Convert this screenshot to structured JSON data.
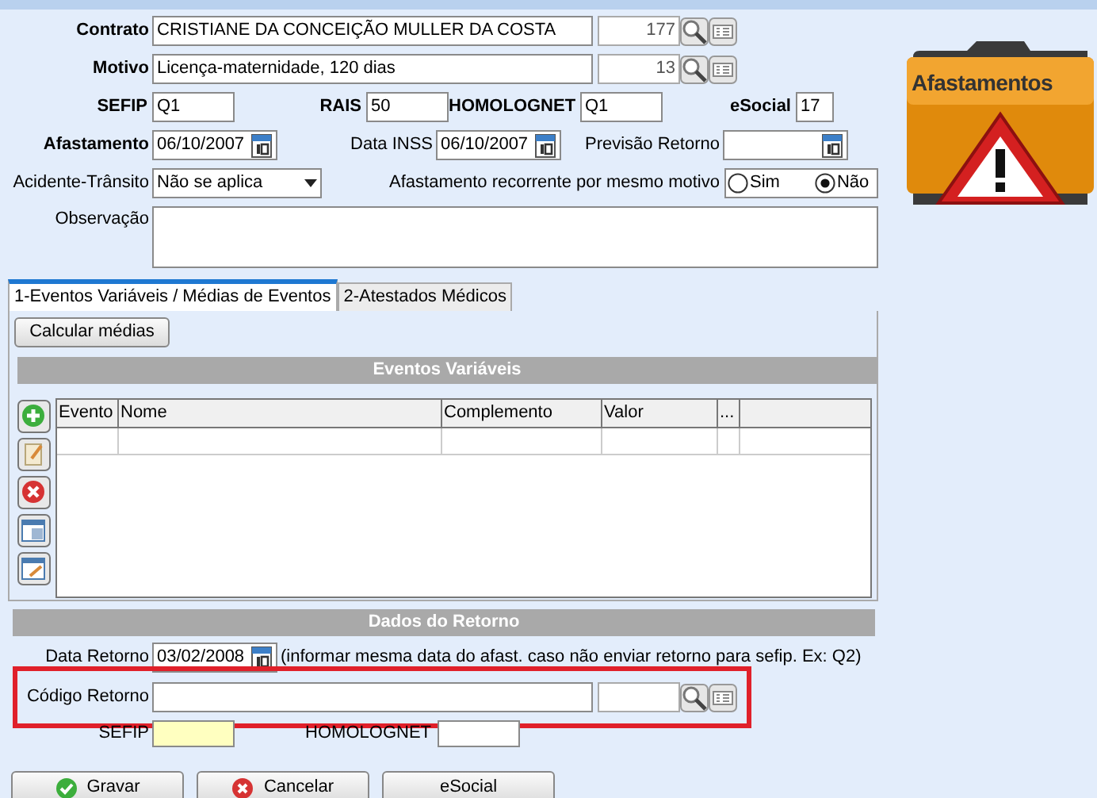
{
  "contrato": {
    "label": "Contrato",
    "value": "CRISTIANE DA CONCEIÇÃO MULLER DA COSTA",
    "code": "177"
  },
  "motivo": {
    "label": "Motivo",
    "value": "Licença-maternidade, 120 dias",
    "code": "13"
  },
  "codes": [
    {
      "label": "SEFIP",
      "value": "Q1"
    },
    {
      "label": "RAIS",
      "value": "50"
    },
    {
      "label": "HOMOLOGNET",
      "value": "Q1"
    },
    {
      "label": "eSocial",
      "value": "17"
    }
  ],
  "dates": [
    {
      "label": "Afastamento",
      "value": "06/10/2007",
      "bold": true
    },
    {
      "label": "Data INSS",
      "value": "06/10/2007",
      "bold": false
    },
    {
      "label": "Previsão Retorno",
      "bold": false
    }
  ],
  "acidente": {
    "label": "Acidente-Trânsito",
    "value": "Não se aplica"
  },
  "recorrente": {
    "label": "Afastamento recorrente por mesmo motivo",
    "options": [
      {
        "label": "Sim",
        "selected": false
      },
      {
        "label": "Não",
        "selected": true
      }
    ]
  },
  "observacao": {
    "label": "Observação"
  },
  "banner": {
    "label": "Afastamentos"
  },
  "tabs": [
    {
      "label": "1-Eventos Variáveis / Médias de Eventos",
      "selected": true
    },
    {
      "label": "2-Atestados Médicos",
      "selected": false
    }
  ],
  "calc_button": "Calcular médias",
  "eventos": {
    "title": "Eventos Variáveis",
    "columns": [
      "Evento",
      "Nome",
      "Complemento",
      "Valor",
      "..."
    ]
  },
  "retorno": {
    "title": "Dados do Retorno",
    "date_label": "Data Retorno",
    "date": "03/02/2008",
    "hint": "(informar mesma data do afast. caso não enviar retorno para sefip. Ex: Q2)",
    "code_label": "Código Retorno",
    "code_highlighted": true,
    "sefip_label": "SEFIP",
    "homolognet_label": "HOMOLOGNET"
  },
  "buttons": [
    {
      "label": "Gravar",
      "kind": "ok"
    },
    {
      "label": "Cancelar",
      "kind": "cancel"
    },
    {
      "label": "eSocial",
      "kind": "plain"
    }
  ]
}
